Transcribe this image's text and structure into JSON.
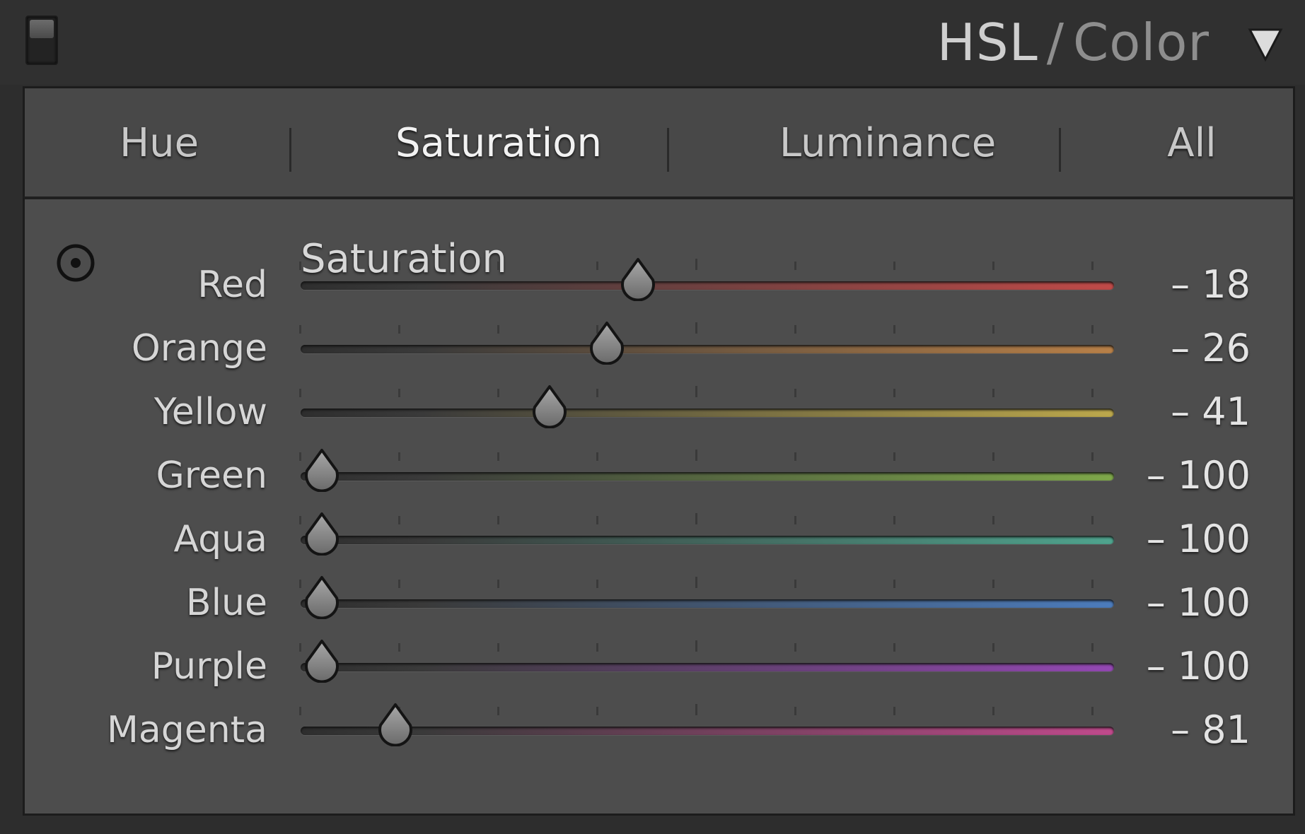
{
  "header": {
    "title_primary": "HSL",
    "title_separator": "/",
    "title_secondary": "Color",
    "collapse_icon": "triangle-down-icon",
    "toggle_icon": "panel-switch-icon"
  },
  "tabs": [
    {
      "label": "Hue",
      "active": false
    },
    {
      "label": "Saturation",
      "active": true
    },
    {
      "label": "Luminance",
      "active": false
    },
    {
      "label": "All",
      "active": false
    }
  ],
  "section": {
    "title": "Saturation",
    "target_tool_icon": "target-adjustment-icon"
  },
  "sliders": [
    {
      "label": "Red",
      "value": -18,
      "value_text": "– 18",
      "color": "#c04a48"
    },
    {
      "label": "Orange",
      "value": -26,
      "value_text": "– 26",
      "color": "#b88048"
    },
    {
      "label": "Yellow",
      "value": -41,
      "value_text": "– 41",
      "color": "#bca84c"
    },
    {
      "label": "Green",
      "value": -100,
      "value_text": "– 100",
      "color": "#7ea84a"
    },
    {
      "label": "Aqua",
      "value": -100,
      "value_text": "– 100",
      "color": "#4fa48e"
    },
    {
      "label": "Blue",
      "value": -100,
      "value_text": "– 100",
      "color": "#4c7cbc"
    },
    {
      "label": "Purple",
      "value": -100,
      "value_text": "– 100",
      "color": "#9448b4"
    },
    {
      "label": "Magenta",
      "value": -81,
      "value_text": "– 81",
      "color": "#c04a8c"
    }
  ],
  "slider_range": [
    -100,
    100
  ],
  "colors": {
    "panel_bg": "#2d2d2d",
    "content_bg": "#4d4d4d",
    "tabbar_bg": "#484848",
    "thumb": "#8a8a8a"
  }
}
